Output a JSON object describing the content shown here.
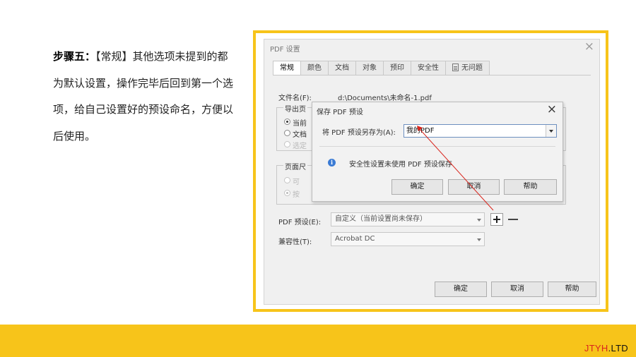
{
  "instruction": {
    "step_label": "步骤五：",
    "body": "【常规】其他选项未提到的都为默认设置，操作完毕后回到第一个选项，给自己设置好的预设命名，方便以后使用。"
  },
  "main_dialog": {
    "title": "PDF 设置",
    "close_glyph": "×",
    "tabs": [
      {
        "label": "常规",
        "active": true
      },
      {
        "label": "颜色"
      },
      {
        "label": "文档"
      },
      {
        "label": "对象"
      },
      {
        "label": "预印"
      },
      {
        "label": "安全性"
      },
      {
        "label": "无问题"
      }
    ],
    "filename_label": "文件名(F):",
    "filename_value": "d:\\Documents\\未命名-1.pdf",
    "export_group_label": "导出页",
    "export_options": [
      "当前",
      "文档",
      "选定"
    ],
    "page_size_group_label": "页面尺",
    "page_size_options": [
      "可",
      "按"
    ],
    "preset_label": "PDF 预设(E):",
    "preset_value": "自定义（当前设置尚未保存）",
    "compat_label": "兼容性(T):",
    "compat_value": "Acrobat DC",
    "buttons": {
      "ok": "确定",
      "cancel": "取消",
      "help": "帮助"
    }
  },
  "save_dialog": {
    "title": "保存 PDF 预设",
    "close_glyph": "×",
    "saveas_label": "将 PDF 预设另存为(A):",
    "saveas_value": "我的PDF",
    "info_icon": "i",
    "info_text": "安全性设置未使用 PDF 预设保存",
    "buttons": {
      "ok": "确定",
      "cancel": "取消",
      "help": "帮助"
    }
  },
  "footer": {
    "brand_part1": "JTYH",
    "brand_part2": ".LTD",
    "bar_color": "#f7c41a",
    "brand_color": "#d9251d"
  },
  "annotation": {
    "arrow_color": "#d9251d"
  }
}
